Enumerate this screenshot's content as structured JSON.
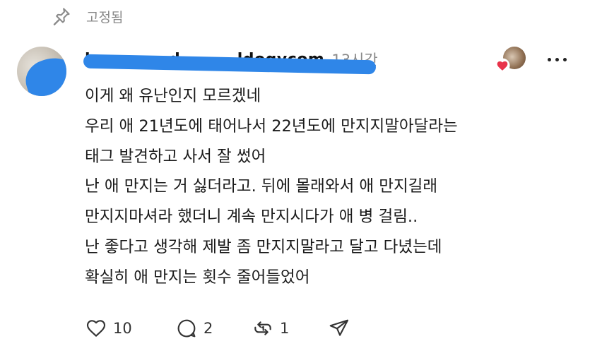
{
  "pinned": {
    "label": "고정됨",
    "icon": "pin-icon"
  },
  "post": {
    "author": {
      "username": "lo___y____d_______ldogycom",
      "time": "13시간"
    },
    "lines": [
      "이게 왜 유난인지 모르겠네",
      "우리 애 21년도에 태어나서 22년도에 만지지말아달라는",
      "태그 발견하고 사서 잘 썼어",
      "난 애 만지는 거 싫더라고. 뒤에 몰래와서 애 만지길래",
      "만지지마셔라 했더니 계속 만지시다가 애 병 걸림..",
      "난 좋다고 생각해 제발 좀 만지지말라고 달고 다녔는데",
      "확실히 애 만지는 횟수 줄어들었어"
    ],
    "actions": {
      "like": {
        "count": "10",
        "icon": "heart-icon"
      },
      "comment": {
        "count": "2",
        "icon": "comment-bubble-icon"
      },
      "repost": {
        "count": "1",
        "icon": "repost-icon"
      },
      "share": {
        "icon": "send-icon"
      }
    },
    "reactor_badge": {
      "icon": "heart-icon",
      "heart_color": "#e8334a"
    }
  },
  "colors": {
    "muted": "#8a8a8a",
    "redaction": "#2f86e8",
    "text": "#1a1a1a"
  }
}
